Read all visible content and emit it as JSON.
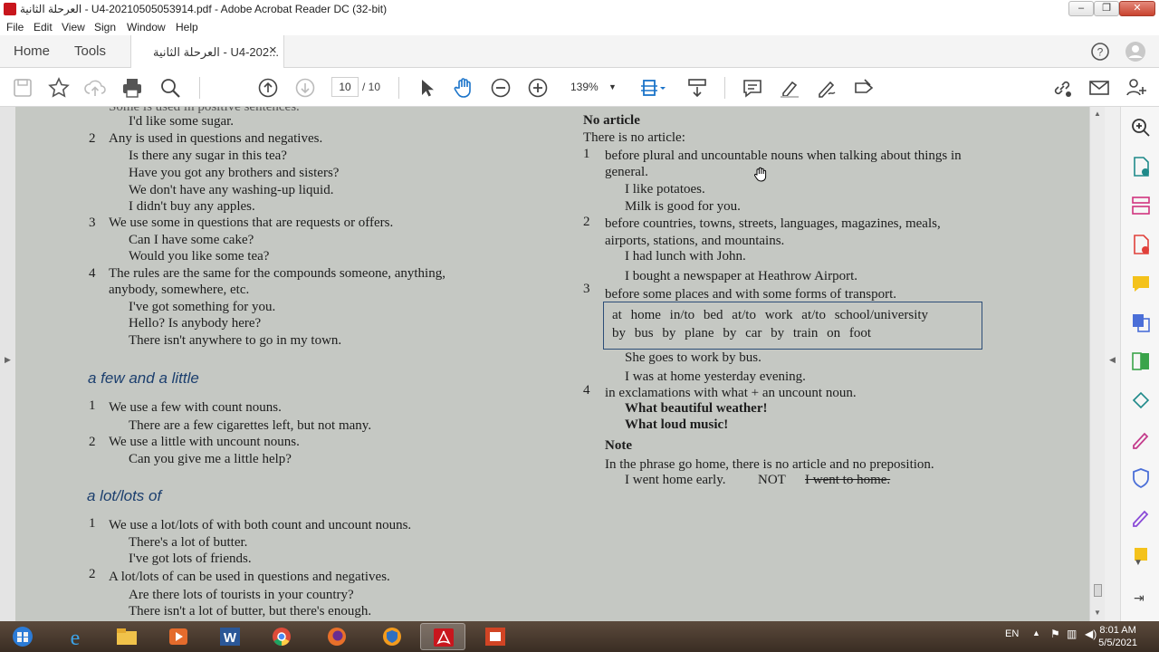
{
  "window": {
    "title": "العرحلة الثانية - U4-20210505053914.pdf - Adobe Acrobat Reader DC (32-bit)",
    "controls": [
      "–",
      "❐",
      "✕"
    ]
  },
  "menu": [
    "File",
    "Edit",
    "View",
    "Sign",
    "Window",
    "Help"
  ],
  "tabs": {
    "home": "Home",
    "tools": "Tools",
    "document": "العرحلة الثانية - U4-202...",
    "close": "×"
  },
  "toolbar": {
    "page_current": "10",
    "page_total": "/ 10",
    "zoom": "139%",
    "icons": [
      "save-icon",
      "bookmark-star-icon",
      "upload-cloud-icon",
      "print-icon",
      "find-icon",
      "page-up-icon",
      "page-down-icon",
      "select-cursor-icon",
      "hand-icon",
      "zoom-out-icon",
      "zoom-in-icon",
      "fit-page-icon",
      "scroll-mode-icon",
      "comment-icon",
      "highlight-icon",
      "sign-icon",
      "fill-sign-icon",
      "share-link-icon",
      "email-icon",
      "add-user-icon"
    ]
  },
  "doc": {
    "left": {
      "top_cut": "Some is used in positive sentences.",
      "l1": "I'd like some sugar.",
      "n2": "2",
      "l2a": "Any is used in questions and negatives.",
      "l2b": "Is there any sugar in this tea?",
      "l2c": "Have you got any brothers and sisters?",
      "l2d": "We don't have any washing-up liquid.",
      "l2e": "I didn't buy any apples.",
      "n3": "3",
      "l3a": "We use some in questions that are requests or offers.",
      "l3b": "Can I have some cake?",
      "l3c": "Would you like some tea?",
      "n4": "4",
      "l4a": "The rules are the same for the compounds someone, anything,",
      "l4b": "anybody, somewhere, etc.",
      "l4c": "I've got something for you.",
      "l4d": "Hello? Is anybody here?",
      "l4e": "There isn't anywhere to go in my town.",
      "head1": "a few and a little",
      "f1n": "1",
      "f1a": "We use a few with count nouns.",
      "f1b": "There are a few cigarettes left, but not many.",
      "f2n": "2",
      "f2a": "We use a little with uncount nouns.",
      "f2b": "Can you give me a little help?",
      "head2": "a lot/lots of",
      "g1n": "1",
      "g1a": "We use a lot/lots of with both count and uncount nouns.",
      "g1b": "There's a lot of butter.",
      "g1c": "I've got lots of friends.",
      "g2n": "2",
      "g2a": "A lot/lots of can be used in questions and negatives.",
      "g2b": "Are there lots of tourists in your country?",
      "g2c": "There isn't a lot of butter, but there's enough."
    },
    "right": {
      "heading": "No article",
      "intro": "There is no article:",
      "r1n": "1",
      "r1a": "before plural and uncountable nouns when talking about things in",
      "r1b": "general.",
      "r1c": "I like potatoes.",
      "r1d": "Milk is good for you.",
      "r2n": "2",
      "r2a": "before countries, towns, streets, languages, magazines, meals,",
      "r2b": "airports, stations, and mountains.",
      "r2c": "I had lunch with John.",
      "r2d": "I bought a newspaper at Heathrow Airport.",
      "r3n": "3",
      "r3a": "before some places and with some forms of transport.",
      "box1": "at home   in/to bed   at/to work   at/to school/university",
      "box2": "by bus   by plane   by car   by train   on foot",
      "r3c": "She goes to work by bus.",
      "r3d": "I was at home yesterday evening.",
      "r4n": "4",
      "r4a": "in exclamations with what + an uncount noun.",
      "r4b": "What beautiful weather!",
      "r4c": "What loud music!",
      "note": "Note",
      "note1": "In the phrase go home, there is no article and no preposition.",
      "note2a": "I went home early.",
      "note2b": "NOT",
      "note2c": "I went to home."
    }
  },
  "taskbar": {
    "lang": "EN",
    "time": "8:01 AM",
    "date": "5/5/2021"
  }
}
